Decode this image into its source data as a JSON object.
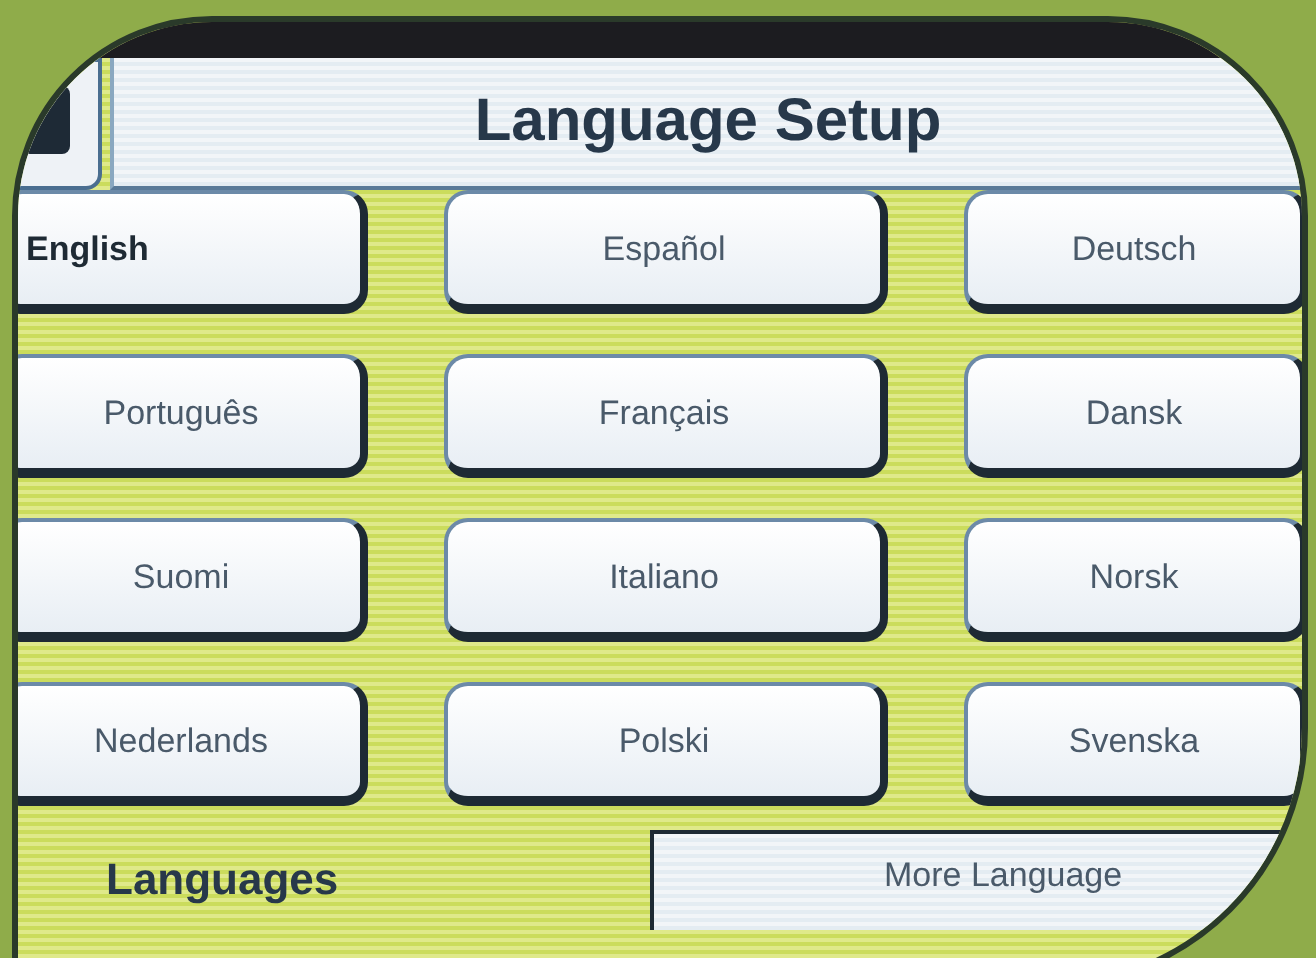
{
  "header": {
    "title": "Language Setup"
  },
  "languages": [
    {
      "label": "English",
      "selected": true
    },
    {
      "label": "Español",
      "selected": false
    },
    {
      "label": "Deutsch",
      "selected": false
    },
    {
      "label": "Português",
      "selected": false
    },
    {
      "label": "Français",
      "selected": false
    },
    {
      "label": "Dansk",
      "selected": false
    },
    {
      "label": "Suomi",
      "selected": false
    },
    {
      "label": "Italiano",
      "selected": false
    },
    {
      "label": "Norsk",
      "selected": false
    },
    {
      "label": "Nederlands",
      "selected": false
    },
    {
      "label": "Polski",
      "selected": false
    },
    {
      "label": "Svenska",
      "selected": false
    }
  ],
  "tabs": [
    {
      "label": "Languages",
      "selected": true
    },
    {
      "label": "More Language",
      "selected": false
    }
  ]
}
